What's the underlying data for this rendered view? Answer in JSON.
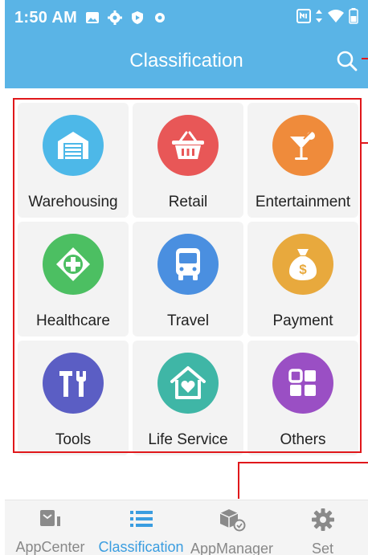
{
  "status_bar": {
    "time": "1:50 AM",
    "left_icons": [
      "image-icon",
      "gear-icon",
      "shield-icon",
      "record-icon"
    ],
    "right_icons": [
      "nfc-icon",
      "data-arrows-icon",
      "wifi-icon",
      "battery-icon"
    ]
  },
  "header": {
    "title": "Classification",
    "search_icon": "search-icon"
  },
  "categories": [
    {
      "label": "Warehousing",
      "icon": "warehouse-icon",
      "color": "#4db8e8"
    },
    {
      "label": "Retail",
      "icon": "basket-icon",
      "color": "#e85757"
    },
    {
      "label": "Entertainment",
      "icon": "cocktail-icon",
      "color": "#ef8b3b"
    },
    {
      "label": "Healthcare",
      "icon": "health-cross-icon",
      "color": "#4cbf62"
    },
    {
      "label": "Travel",
      "icon": "bus-icon",
      "color": "#4a8fe0"
    },
    {
      "label": "Payment",
      "icon": "money-bag-icon",
      "color": "#e8a93d"
    },
    {
      "label": "Tools",
      "icon": "tools-icon",
      "color": "#5b5ec4"
    },
    {
      "label": "Life Service",
      "icon": "home-heart-icon",
      "color": "#3fb6a6"
    },
    {
      "label": "Others",
      "icon": "grid-icon",
      "color": "#9a4fc4"
    }
  ],
  "bottom_nav": {
    "items": [
      {
        "label": "AppCenter",
        "icon": "app-center-icon",
        "active": false
      },
      {
        "label": "Classification",
        "icon": "list-icon",
        "active": true
      },
      {
        "label": "AppManager",
        "icon": "package-gear-icon",
        "active": false
      },
      {
        "label": "Set",
        "icon": "settings-gear-icon",
        "active": false
      }
    ]
  },
  "colors": {
    "header_bg": "#5ab4e6",
    "accent": "#3a9de0",
    "annotation": "#e0181b",
    "tile_bg": "#f3f3f3"
  }
}
